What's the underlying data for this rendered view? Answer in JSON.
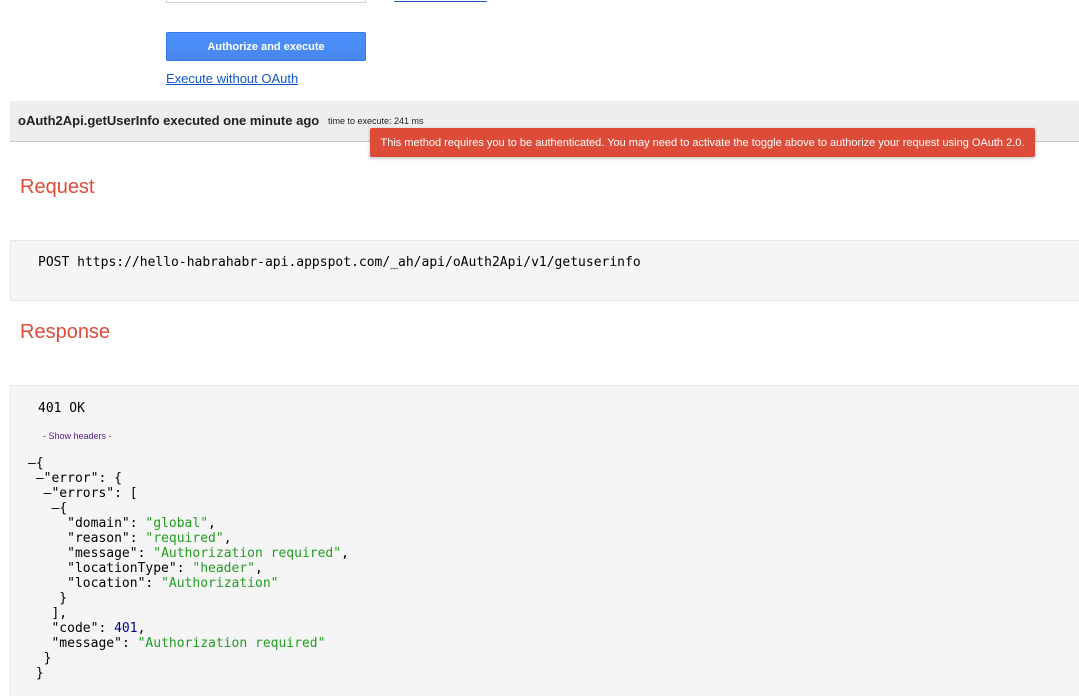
{
  "auth": {
    "authorize_button": "Authorize and execute",
    "execute_link": "Execute without OAuth"
  },
  "execution": {
    "title": "oAuth2Api.getUserInfo executed one minute ago",
    "time": "time to execute: 241 ms"
  },
  "tooltip": {
    "text": "This method requires you to be authenticated. You may need to activate the toggle above to authorize your request using OAuth 2.0."
  },
  "request": {
    "heading": "Request",
    "line": "POST https://hello-habrahabr-api.appspot.com/_ah/api/oAuth2Api/v1/getuserinfo"
  },
  "response": {
    "heading": "Response",
    "status": "401 OK",
    "show_headers": "- Show headers -",
    "body": {
      "toggle": "–",
      "open_brace": "{",
      "error_key": "\"error\"",
      "errors_key": "\"errors\"",
      "domain_key": "\"domain\"",
      "domain_val": "\"global\"",
      "reason_key": "\"reason\"",
      "reason_val": "\"required\"",
      "message_key": "\"message\"",
      "message_val": "\"Authorization required\"",
      "locationType_key": "\"locationType\"",
      "locationType_val": "\"header\"",
      "location_key": "\"location\"",
      "location_val": "\"Authorization\"",
      "code_key": "\"code\"",
      "code_val": "401",
      "outer_message_key": "\"message\"",
      "outer_message_val": "\"Authorization required\""
    }
  },
  "colors": {
    "accent_red": "#dd4b39",
    "button_blue": "#4d90fe",
    "json_string": "#239d23",
    "json_number": "#000088"
  }
}
